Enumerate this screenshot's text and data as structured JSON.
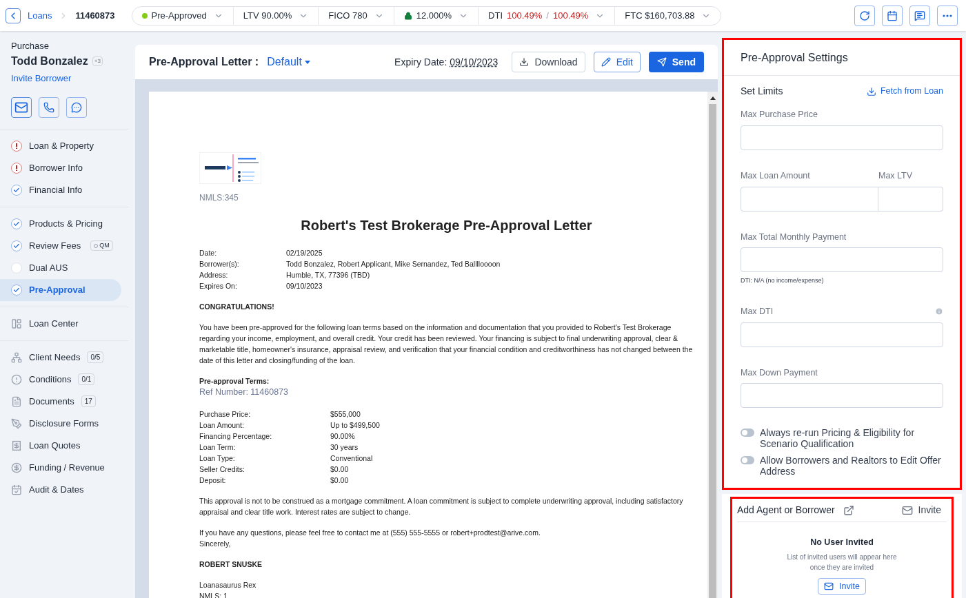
{
  "breadcrumb": {
    "parent": "Loans",
    "current": "11460873"
  },
  "status_pills": [
    {
      "kind": "status",
      "label": "Pre-Approved",
      "color": "#84cc16"
    },
    {
      "kind": "plain",
      "label": "LTV 90.00%"
    },
    {
      "kind": "plain",
      "label": "FICO 780"
    },
    {
      "kind": "locked",
      "label": "12.000%"
    },
    {
      "kind": "ratio",
      "label": "DTI",
      "value": "100.49%",
      "separator": "/",
      "value_2": "100.49%"
    },
    {
      "kind": "plain",
      "label": "FTC $160,703.88"
    }
  ],
  "sidebar": {
    "loan_type": "Purchase",
    "borrower": "Todd Bonzalez",
    "extra_count": "+3",
    "invite_link": "Invite Borrower",
    "groups": [
      [
        {
          "label": "Loan & Property",
          "kind": "error",
          "selected": false
        },
        {
          "label": "Borrower Info",
          "kind": "error",
          "selected": false
        },
        {
          "label": "Financial Info",
          "kind": "done",
          "selected": false
        }
      ],
      [
        {
          "label": "Products & Pricing",
          "kind": "done",
          "selected": false
        },
        {
          "label": "Review Fees",
          "kind": "done",
          "selected": false,
          "tag": "QM"
        },
        {
          "label": "Dual AUS",
          "kind": "pending",
          "selected": false
        },
        {
          "label": "Pre-Approval",
          "kind": "done",
          "selected": true
        }
      ]
    ],
    "center": {
      "label": "Loan Center"
    },
    "tools": [
      {
        "label": "Client Needs",
        "badge": "0/5"
      },
      {
        "label": "Conditions",
        "badge": "0/1"
      },
      {
        "label": "Documents",
        "badge": "17"
      },
      {
        "label": "Disclosure Forms"
      },
      {
        "label": "Loan Quotes"
      },
      {
        "label": "Funding / Revenue"
      },
      {
        "label": "Audit & Dates"
      }
    ]
  },
  "letter_panel": {
    "title": "Pre-Approval Letter :",
    "template": "Default",
    "expiry_label": "Expiry Date:",
    "expiry_date": "09/10/2023",
    "buttons": [
      "Download",
      "Edit",
      "Send"
    ]
  },
  "letter": {
    "nmls": "NMLS:345",
    "heading": "Robert's Test Brokerage Pre-Approval Letter",
    "details": [
      [
        "Date:",
        "02/19/2025"
      ],
      [
        "Borrower(s):",
        "Todd Bonzalez, Robert Applicant, Mike Sernandez, Ted Balllloooon"
      ],
      [
        "Address:",
        "Humble, TX, 77396 (TBD)"
      ],
      [
        "Expires On:",
        "09/10/2023"
      ]
    ],
    "greeting": "CONGRATULATIONS!",
    "intro": "You have been pre-approved for the following loan terms based on the information and documentation that you provided to Robert's Test Brokerage regarding your income, employment, and overall credit. Your credit has been reviewed. Your financing is subject to final underwriting approval, clear & marketable title, homeowner's insurance, appraisal review, and verification that your financial condition and creditworthiness has not changed between the date of this letter and closing/funding of the loan.",
    "terms_heading": "Pre-approval Terms:",
    "ref_number": "Ref Number: 11460873",
    "terms": [
      [
        "Purchase Price:",
        "$555,000"
      ],
      [
        "Loan Amount:",
        "Up to $499,500"
      ],
      [
        "Financing Percentage:",
        "90.00%"
      ],
      [
        "Loan Term:",
        "30 years"
      ],
      [
        "Loan Type:",
        "Conventional"
      ],
      [
        "Seller Credits:",
        "$0.00"
      ],
      [
        "Deposit:",
        "$0.00"
      ]
    ],
    "disclaimer": "This approval is not to be construed as a mortgage commitment. A loan commitment is subject to complete underwriting approval, including satisfactory appraisal and clear title work. Interest rates are subject to change.",
    "contact": "If you have any questions, please feel free to contact me at (555) 555-5555 or robert+prodtest@arive.com.",
    "closing": "Sincerely,",
    "signer": "ROBERT SNUSKE",
    "signer_title": "Loanasaurus Rex",
    "signer_nmls": "NMLS: 1"
  },
  "settings": {
    "title": "Pre-Approval Settings",
    "section": "Set Limits",
    "fetch": "Fetch from Loan",
    "fields": [
      {
        "kind": "single",
        "label": "Max Purchase Price"
      },
      {
        "kind": "pair",
        "label": "Max Loan Amount",
        "label_2": "Max LTV"
      },
      {
        "kind": "single",
        "label": "Max Total Monthly Payment",
        "hint": "DTI: N/A (no income/expense)"
      },
      {
        "kind": "info",
        "label": "Max DTI"
      },
      {
        "kind": "single",
        "label": "Max Down Payment"
      }
    ],
    "toggles": [
      {
        "label": "Always re-run Pricing & Eligibility for Scenario Qualification",
        "on": false
      },
      {
        "label": "Allow Borrowers and Realtors to Edit Offer Address",
        "on": false
      }
    ]
  },
  "invite_card": {
    "title": "Add Agent or Borrower",
    "action": "Invite",
    "empty_title": "No User Invited",
    "empty_text": "List of invited users will appear here once they are invited",
    "button": "Invite"
  }
}
